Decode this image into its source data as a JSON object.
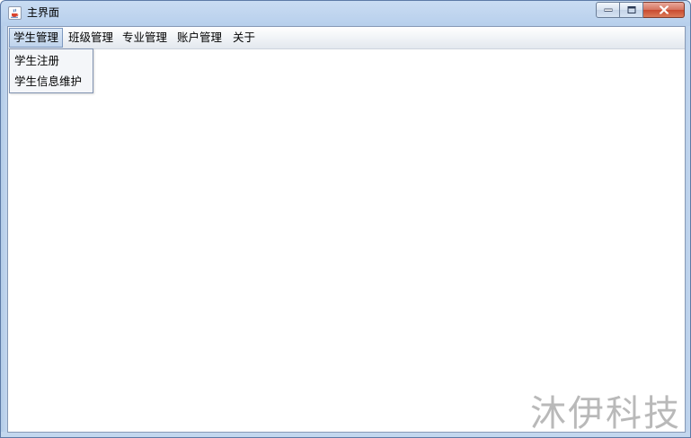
{
  "window": {
    "title": "主界面",
    "icon": "java-cup-icon",
    "controls": [
      "minimize-icon",
      "maximize-icon",
      "close-icon"
    ]
  },
  "menubar": {
    "items": [
      {
        "label": "学生管理",
        "active": true
      },
      {
        "label": "班级管理"
      },
      {
        "label": "专业管理"
      },
      {
        "label": "账户管理"
      },
      {
        "label": "关于"
      }
    ]
  },
  "dropdown": {
    "items": [
      {
        "label": "学生注册"
      },
      {
        "label": "学生信息维护"
      }
    ]
  },
  "watermark": "沐伊科技",
  "colors": {
    "titlebar": "#b7cfec",
    "close_button": "#c8492f",
    "menu_active": "#bfd3ec"
  }
}
